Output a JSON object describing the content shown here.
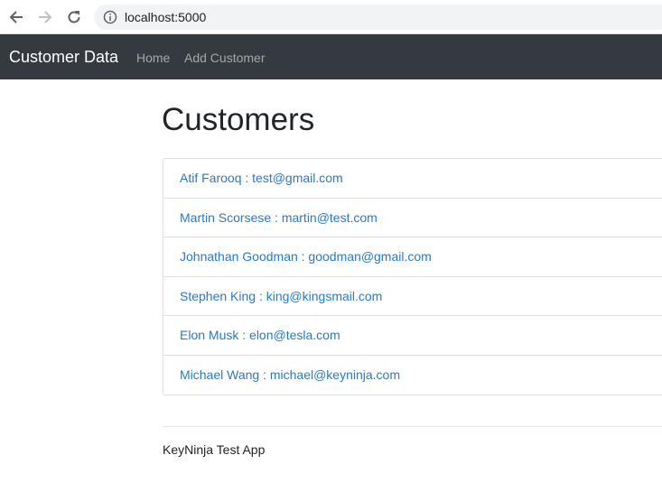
{
  "browser": {
    "url": "localhost:5000"
  },
  "navbar": {
    "brand": "Customer Data",
    "links": [
      "Home",
      "Add Customer"
    ],
    "background": "#343a40"
  },
  "main": {
    "title": "Customers",
    "customers": [
      {
        "label": "Atif Farooq : test@gmail.com"
      },
      {
        "label": "Martin Scorsese : martin@test.com"
      },
      {
        "label": "Johnathan Goodman : goodman@gmail.com"
      },
      {
        "label": "Stephen King : king@kingsmail.com"
      },
      {
        "label": "Elon Musk : elon@tesla.com"
      },
      {
        "label": "Michael Wang : michael@keyninja.com"
      }
    ],
    "link_color": "#2a7ac4"
  },
  "footer": {
    "text": "KeyNinja Test App"
  }
}
